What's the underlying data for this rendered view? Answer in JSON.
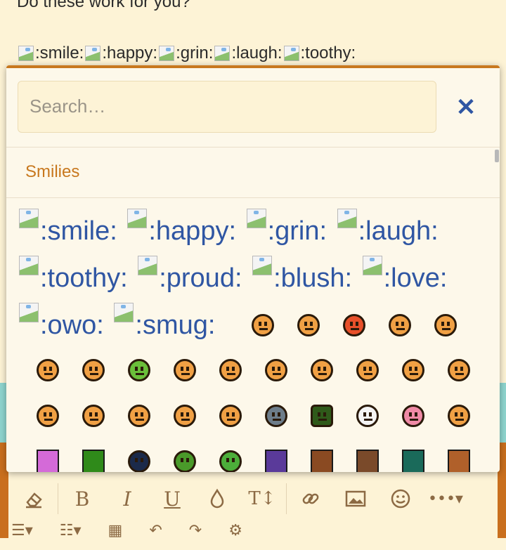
{
  "post": {
    "question": "Do these work for you?",
    "inline_emotes": [
      ":smile:",
      ":happy:",
      ":grin:",
      ":laugh:",
      ":toothy:"
    ]
  },
  "popup": {
    "search": {
      "placeholder": "Search…",
      "value": ""
    },
    "close_icon": "close-icon",
    "section_title": "Smilies",
    "text_emotes": [
      ":smile:",
      ":happy:",
      ":grin:",
      ":laugh:",
      ":toothy:",
      ":proud:",
      ":blush:",
      ":love:",
      ":owo:",
      ":smug:"
    ],
    "sprite_colors": {
      "orange": "#f0a044",
      "red": "#e8502a",
      "green": "#6abf3a",
      "gray": "#6d7d8a",
      "darkgreen": "#2f5a1a",
      "white": "#f4f4f4",
      "pink": "#f08aa6",
      "purple": "#d46ad8",
      "navy": "#1b2a4a",
      "brown": "#8a4a22"
    }
  },
  "toolbar": {
    "buttons": [
      "eraser-icon",
      "bold-icon",
      "italic-icon",
      "underline-icon",
      "drop-icon",
      "text-size-icon",
      "link-icon",
      "image-icon",
      "smiley-icon",
      "more-icon"
    ],
    "bold_label": "B",
    "italic_label": "I",
    "underline_label": "U"
  },
  "colors": {
    "accent": "#c8781e",
    "link": "#2f56a3",
    "background": "#fdf3d6"
  }
}
